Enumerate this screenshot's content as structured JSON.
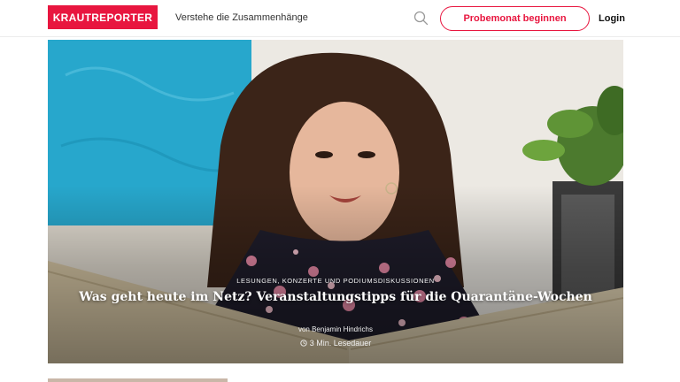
{
  "header": {
    "logo_text": "KRAUTREPORTER",
    "tagline": "Verstehe die Zusammenhänge",
    "search_icon": "search-icon",
    "cta_label": "Probemonat beginnen",
    "login_label": "Login"
  },
  "hero": {
    "category": "Lesungen, Konzerte und Podiumsdiskussionen",
    "title": "Was geht heute im Netz? Veranstaltungstipps für die Quarantäne-Wochen",
    "byline": "von Benjamin Hindrichs",
    "read_time": "3 Min. Lesedauer",
    "clock_icon": "clock-icon"
  },
  "colors": {
    "brand": "#e8163f",
    "wall_art": "#27a7cc"
  }
}
